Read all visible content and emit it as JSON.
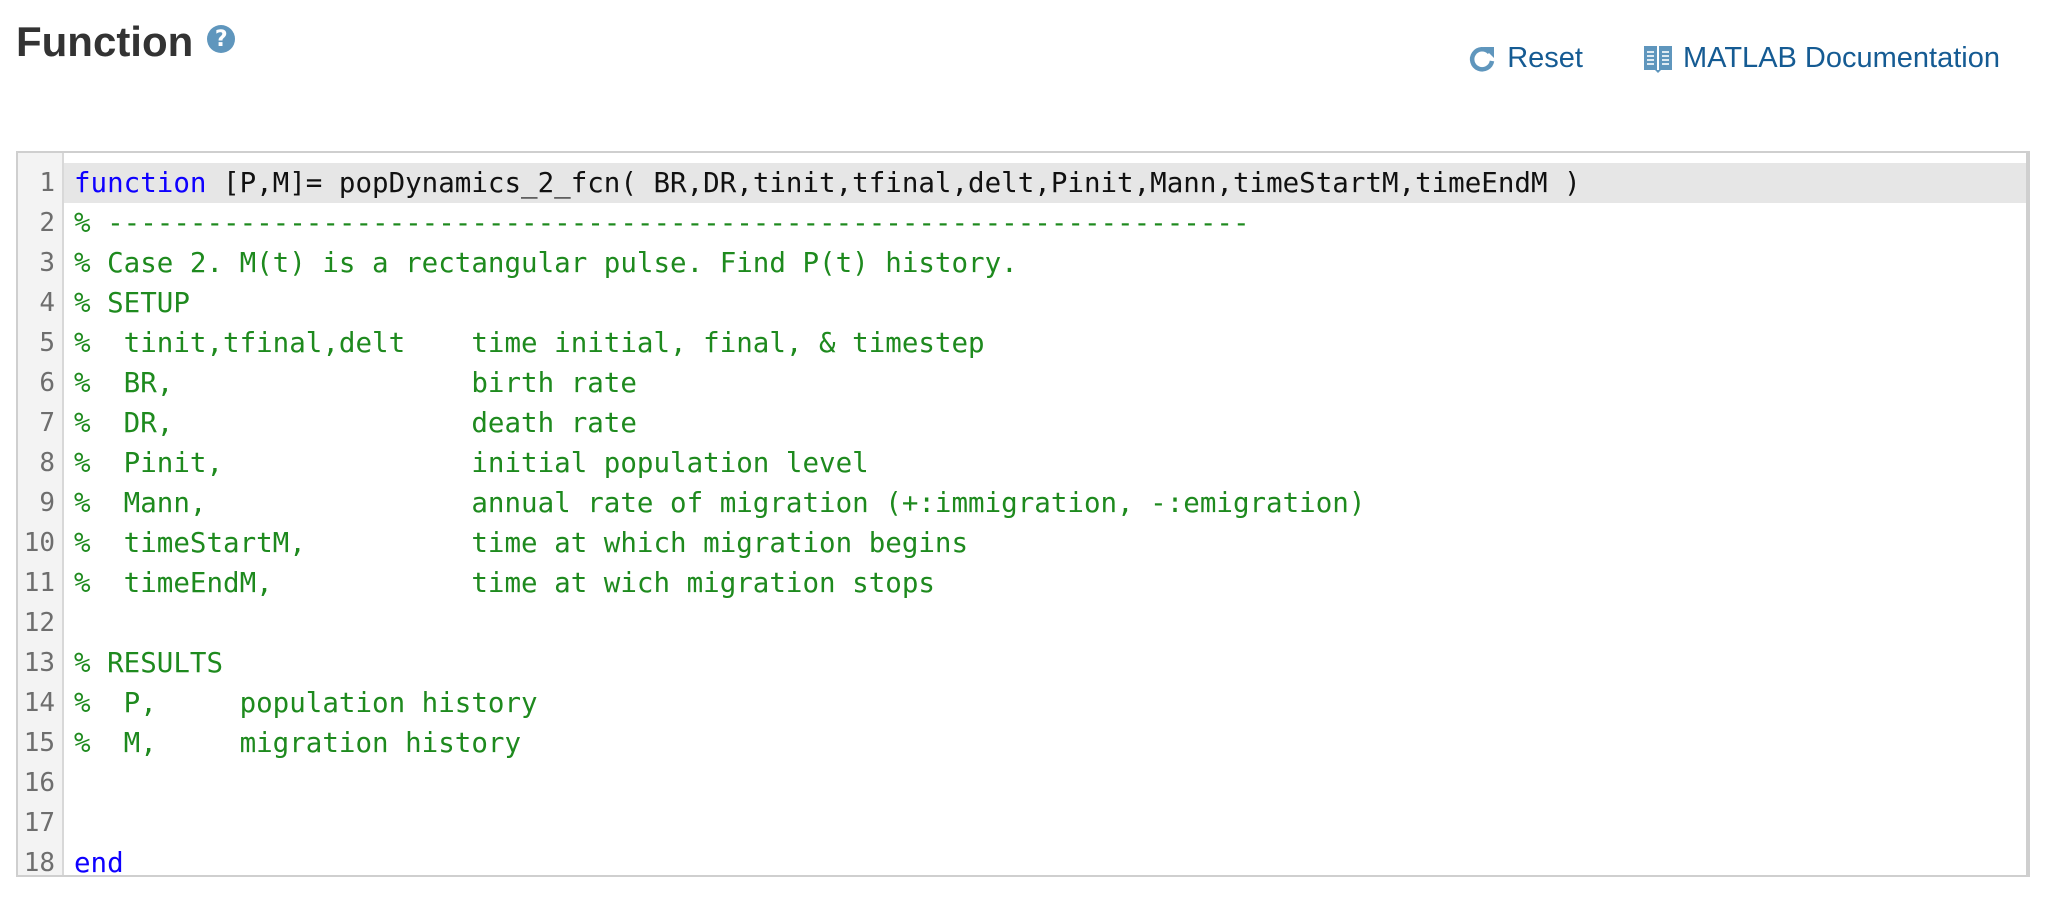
{
  "header": {
    "title": "Function",
    "help_icon": "question-circle-icon",
    "reset_label": "Reset",
    "reset_icon": "refresh-icon",
    "docs_label": "MATLAB Documentation",
    "docs_icon": "book-icon"
  },
  "colors": {
    "keyword": "#0e00ff",
    "comment": "#1e8a1e",
    "link": "#155b93",
    "help_icon": "#5f96bd",
    "active_line": "#e6e6e6"
  },
  "editor": {
    "active_line": 1,
    "lines": [
      {
        "n": "1",
        "kw": "function",
        "text": " [P,M]= popDynamics_2_fcn( BR,DR,tinit,tfinal,delt,Pinit,Mann,timeStartM,timeEndM )",
        "comment": ""
      },
      {
        "n": "2",
        "kw": "",
        "text": "",
        "comment": "% ---------------------------------------------------------------------"
      },
      {
        "n": "3",
        "kw": "",
        "text": "",
        "comment": "% Case 2. M(t) is a rectangular pulse. Find P(t) history."
      },
      {
        "n": "4",
        "kw": "",
        "text": "",
        "comment": "% SETUP"
      },
      {
        "n": "5",
        "kw": "",
        "text": "",
        "comment": "%  tinit,tfinal,delt    time initial, final, & timestep"
      },
      {
        "n": "6",
        "kw": "",
        "text": "",
        "comment": "%  BR,                  birth rate"
      },
      {
        "n": "7",
        "kw": "",
        "text": "",
        "comment": "%  DR,                  death rate"
      },
      {
        "n": "8",
        "kw": "",
        "text": "",
        "comment": "%  Pinit,               initial population level"
      },
      {
        "n": "9",
        "kw": "",
        "text": "",
        "comment": "%  Mann,                annual rate of migration (+:immigration, -:emigration)"
      },
      {
        "n": "10",
        "kw": "",
        "text": "",
        "comment": "%  timeStartM,          time at which migration begins"
      },
      {
        "n": "11",
        "kw": "",
        "text": "",
        "comment": "%  timeEndM,            time at wich migration stops"
      },
      {
        "n": "12",
        "kw": "",
        "text": "",
        "comment": ""
      },
      {
        "n": "13",
        "kw": "",
        "text": "",
        "comment": "% RESULTS"
      },
      {
        "n": "14",
        "kw": "",
        "text": "",
        "comment": "%  P,     population history"
      },
      {
        "n": "15",
        "kw": "",
        "text": "",
        "comment": "%  M,     migration history"
      },
      {
        "n": "16",
        "kw": "",
        "text": "",
        "comment": ""
      },
      {
        "n": "17",
        "kw": "",
        "text": "",
        "comment": ""
      },
      {
        "n": "18",
        "kw": "end",
        "text": "",
        "comment": ""
      }
    ]
  }
}
